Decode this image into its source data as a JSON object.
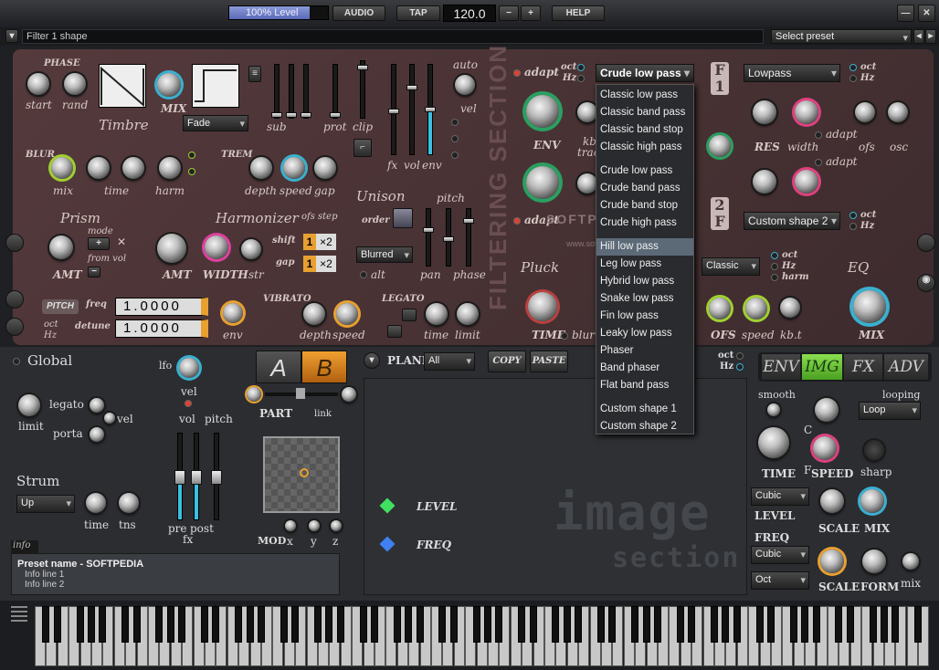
{
  "topbar": {
    "level": "100% Level",
    "audio": "AUDIO",
    "tap": "TAP",
    "tempo": "120.0",
    "minus": "−",
    "plus": "+",
    "help": "HELP",
    "minimize": "—",
    "close": "✕"
  },
  "header": {
    "hint": "Filter 1 shape",
    "preset": "Select preset"
  },
  "timbre": {
    "phase": "PHASE",
    "start": "start",
    "rand": "rand",
    "title": "Timbre",
    "mix": "MIX",
    "fade": "Fade",
    "sub": "sub",
    "prot": "prot",
    "clip": "clip",
    "fx": "fx",
    "vol": "vol",
    "env": "env",
    "auto": "auto",
    "vel": "vel"
  },
  "blur": {
    "title": "BLUR",
    "mix": "mix",
    "time": "time",
    "harm": "harm"
  },
  "trem": {
    "title": "TREM",
    "depth": "depth",
    "speed": "speed",
    "gap": "gap"
  },
  "unison": {
    "title": "Unison",
    "pitch": "pitch",
    "order": "order",
    "mode": "Blurred",
    "alt": "alt",
    "pan": "pan",
    "phase": "phase"
  },
  "prism": {
    "title": "Prism",
    "mode": "mode",
    "fromvol": "from vol",
    "amt": "AMT"
  },
  "harmonizer": {
    "title": "Harmonizer",
    "ofs_step": "ofs step",
    "shift": "shift",
    "gap": "gap",
    "amt": "AMT",
    "width": "WIDTH",
    "str": "str",
    "x1": "1",
    "x2": "×2",
    "x3": "1",
    "x4": "×2"
  },
  "pitch": {
    "title": "PITCH",
    "freq": "freq",
    "detune": "detune",
    "oct": "oct",
    "hz": "Hz",
    "freqval": "1.0000",
    "detuneval": "1.0000",
    "env": "env"
  },
  "vibrato": {
    "title": "VIBRATO",
    "depth": "depth",
    "speed": "speed"
  },
  "legato": {
    "title": "LEGATO",
    "time": "time",
    "limit": "limit"
  },
  "filter": {
    "adapt": "adapt",
    "oct": "oct",
    "hz": "Hz",
    "selected": "Crude low pass",
    "env": "ENV",
    "kb": "kb",
    "track": "track",
    "pluck": "Pluck",
    "time": "TIME",
    "blur": "blur",
    "adapt2": "adapt",
    "section": "FILTERING SECTION",
    "watermark": "SOFTPEDIA",
    "wm2": "www.softpedia.com"
  },
  "dropdown": {
    "groups": [
      [
        "Classic low pass",
        "Classic band pass",
        "Classic band stop",
        "Classic high pass"
      ],
      [
        "Crude low pass",
        "Crude band pass",
        "Crude band stop",
        "Crude high pass"
      ],
      [
        "Hill low pass",
        "Leg low pass",
        "Hybrid low pass",
        "Snake low pass",
        "Fin low pass",
        "Leaky low pass",
        "Phaser",
        "Band phaser",
        "Flat band pass"
      ],
      [
        "Custom shape 1",
        "Custom shape 2"
      ]
    ],
    "highlighted": "Hill low pass"
  },
  "filter2": {
    "f1": "F1",
    "f2": "F2",
    "type1": "Lowpass",
    "type2": "Custom shape 2",
    "oct": "oct",
    "hz": "Hz",
    "res": "RES",
    "width": "width",
    "adapt": "adapt",
    "ofs": "ofs",
    "osc": "osc",
    "harm": "harm",
    "classic": "Classic",
    "eq": "EQ",
    "ofs2": "OFS",
    "speed": "speed",
    "kbt": "kb.t",
    "mix": "MIX"
  },
  "global": {
    "title": "Global",
    "lfo": "lfo",
    "legato": "legato",
    "vel": "vel",
    "porta": "porta",
    "limit": "limit",
    "strum": "Strum",
    "up": "Up",
    "time": "time",
    "tns": "tns",
    "vel2": "vel",
    "vol": "vol",
    "pitch": "pitch",
    "pre": "pre",
    "post": "post",
    "fx": "fx"
  },
  "part": {
    "a": "A",
    "b": "B",
    "part": "PART",
    "link": "link",
    "mod": "MOD",
    "x": "x",
    "y": "y",
    "z": "z"
  },
  "plane": {
    "label": "PLANE",
    "all": "All",
    "copy": "COPY",
    "paste": "PASTE",
    "level": "LEVEL",
    "freq": "FREQ",
    "oct": "oct",
    "hz": "Hz",
    "image1": "image",
    "image2": "section"
  },
  "tabs": [
    "ENV",
    "IMG",
    "FX",
    "ADV"
  ],
  "right": {
    "smooth": "smooth",
    "looping": "looping",
    "loop": "Loop",
    "time": "TIME",
    "speed": "SPEED",
    "sharp": "sharp",
    "cubic1": "Cubic",
    "level": "LEVEL",
    "scale": "SCALE",
    "mix": "MIX",
    "freq": "FREQ",
    "cubic2": "Cubic",
    "oct": "Oct",
    "scale2": "SCALE",
    "form": "FORM",
    "mix2": "mix",
    "c": "C",
    "f": "F"
  },
  "info": {
    "tab": "info",
    "name": "Preset name - SOFTPEDIA",
    "line1": "Info line 1",
    "line2": "Info line 2"
  }
}
